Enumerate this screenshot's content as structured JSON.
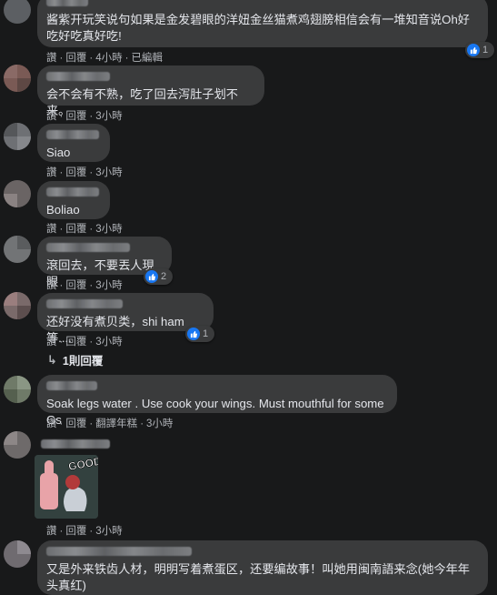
{
  "comments": [
    {
      "text": "酱紫开玩笑说句如果是金发碧眼的洋妞金丝猫煮鸡翅膀相信会有一堆知音说Oh好吃好吃真好吃!",
      "like": "讚",
      "reply": "回覆",
      "time": "4小時",
      "edited": "已編輯",
      "reaction_count": ""
    },
    {
      "text": "会不会有不熟，吃了回去泻肚子划不来。",
      "like": "讚",
      "reply": "回覆",
      "time": "3小時"
    },
    {
      "text": "Siao",
      "like": "讚",
      "reply": "回覆",
      "time": "3小時"
    },
    {
      "text": "Boliao",
      "like": "讚",
      "reply": "回覆",
      "time": "3小時"
    },
    {
      "text": "滾回去，不要丟人現眼",
      "like": "讚",
      "reply": "回覆",
      "time": "3小時",
      "reaction_count": "2"
    },
    {
      "text": "还好没有煮贝类，shi ham 等....",
      "like": "讚",
      "reply": "回覆",
      "time": "3小時",
      "reaction_count": "1",
      "replies_label": "1則回覆"
    },
    {
      "text": "Soak legs water . Use cook your wings. Must mouthful for some Gs",
      "like": "讚",
      "reply": "回覆",
      "translate": "翻譯年糕",
      "time": "3小時"
    },
    {
      "sticker_text": "GOOD",
      "like": "讚",
      "reply": "回覆",
      "time": "3小時"
    },
    {
      "text": "又是外来铁齿人材，明明写着煮蛋区，还要编故事！叫她用闽南語来念(她今年年头真红)"
    }
  ],
  "icons": {
    "like": "like-icon",
    "reply_arrow": "reply-arrow-icon"
  },
  "colors": {
    "background": "#18191a",
    "bubble": "#3a3b3c",
    "like": "#1877f2",
    "meta": "#b0b3b8"
  }
}
